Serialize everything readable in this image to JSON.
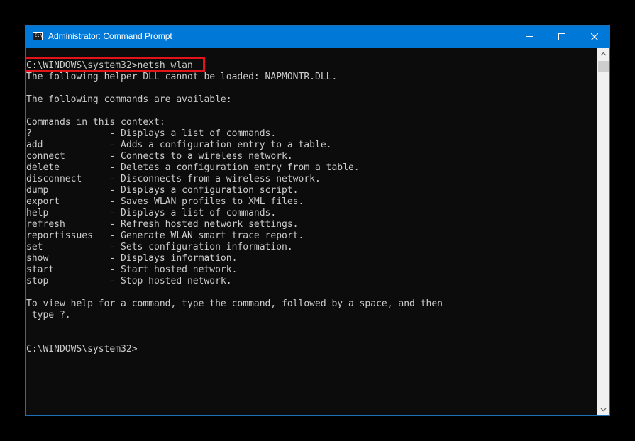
{
  "window": {
    "title": "Administrator: Command Prompt"
  },
  "console": {
    "lines": [
      "C:\\WINDOWS\\system32>netsh wlan",
      "The following helper DLL cannot be loaded: NAPMONTR.DLL.",
      "",
      "The following commands are available:",
      "",
      "Commands in this context:",
      "?              - Displays a list of commands.",
      "add            - Adds a configuration entry to a table.",
      "connect        - Connects to a wireless network.",
      "delete         - Deletes a configuration entry from a table.",
      "disconnect     - Disconnects from a wireless network.",
      "dump           - Displays a configuration script.",
      "export         - Saves WLAN profiles to XML files.",
      "help           - Displays a list of commands.",
      "refresh        - Refresh hosted network settings.",
      "reportissues   - Generate WLAN smart trace report.",
      "set            - Sets configuration information.",
      "show           - Displays information.",
      "start          - Start hosted network.",
      "stop           - Stop hosted network.",
      "",
      "To view help for a command, type the command, followed by a space, and then",
      " type ?.",
      "",
      "",
      "C:\\WINDOWS\\system32>"
    ]
  },
  "colors": {
    "titlebar": "#0078d7",
    "console_bg": "#0c0c0c",
    "console_text": "#cccccc",
    "highlight": "#e2141a"
  }
}
